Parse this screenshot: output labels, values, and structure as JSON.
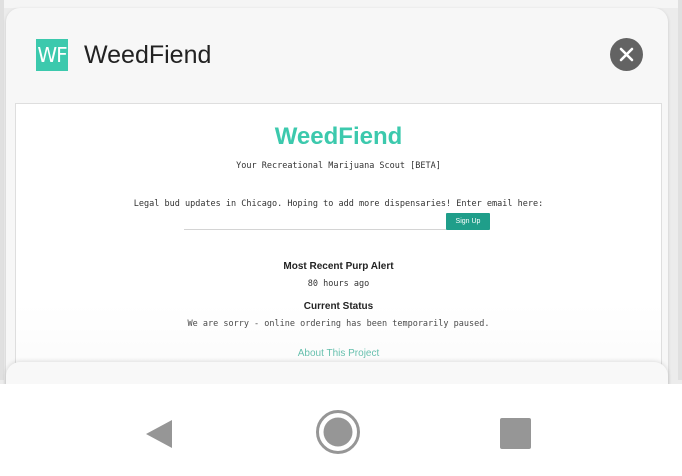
{
  "card": {
    "app_icon_text": "WF",
    "app_title": "WeedFiend"
  },
  "preview": {
    "site_title": "WeedFiend",
    "subtitle": "Your Recreational Marijuana Scout [BETA]",
    "description": "Legal bud updates in Chicago. Hoping to add more dispensaries! Enter email here:",
    "signup_label": "Sign Up",
    "alert_heading": "Most Recent Purp Alert",
    "alert_value": "80 hours ago",
    "status_heading": "Current Status",
    "status_value": "We are sorry - online ordering has been temporarily paused.",
    "about_link": "About This Project"
  },
  "navbar": {
    "back": "back-icon",
    "home": "home-icon",
    "recents": "recents-icon"
  },
  "colors": {
    "brand": "#3cc9ad",
    "button": "#1f9e8a",
    "close_bg": "#636363",
    "nav_icons": "#969696"
  }
}
